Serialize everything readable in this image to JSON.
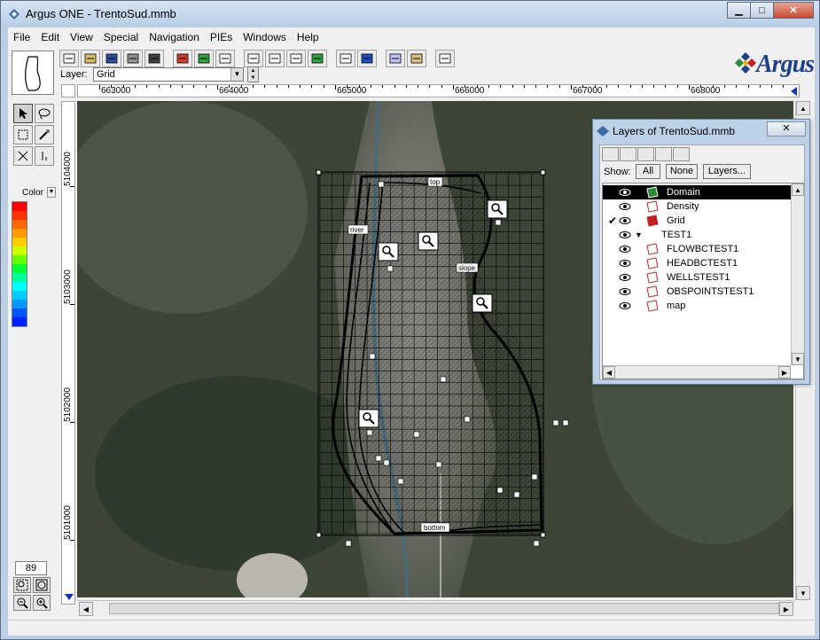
{
  "window": {
    "title": "Argus ONE - TrentoSud.mmb",
    "minimize": "▁",
    "maximize": "□",
    "close": "✕"
  },
  "menu": [
    "File",
    "Edit",
    "View",
    "Special",
    "Navigation",
    "PIEs",
    "Windows",
    "Help"
  ],
  "toolbar": {
    "layer_label": "Layer:",
    "layer_value": "Grid",
    "icons": [
      "new-icon",
      "open-icon",
      "save-icon",
      "print-icon",
      "find-icon",
      "color-icon",
      "layers-icon",
      "grid-icon",
      "zoom-extents-icon",
      "matrix-icon",
      "delete-icon",
      "export-icon",
      "table-icon",
      "run-icon",
      "settings-icon",
      "import-icon",
      "expand-icon"
    ]
  },
  "brand": {
    "name": "Argus"
  },
  "ruler": {
    "x_labels": [
      "663000",
      "664000",
      "665000",
      "666000",
      "667000",
      "668000"
    ],
    "y_labels": [
      "5104000",
      "5103000",
      "5102000",
      "5101000"
    ]
  },
  "palette": {
    "color_label": "Color",
    "colors": [
      "#ff0000",
      "#ff3300",
      "#ff6600",
      "#ff9900",
      "#ffcc00",
      "#ccff00",
      "#66ff00",
      "#00ff33",
      "#00ff99",
      "#00ffff",
      "#00ccff",
      "#0099ff",
      "#0055ff",
      "#0022ff"
    ],
    "zoom_value": "89"
  },
  "map": {
    "labels": [
      "top",
      "river",
      "slope",
      "bottom"
    ]
  },
  "layers_window": {
    "title": "Layers of TrentoSud.mmb",
    "close_glyph": "✕",
    "show_label": "Show:",
    "all_button": "All",
    "none_button": "None",
    "layers_button": "Layers...",
    "items": [
      {
        "name": "Domain",
        "selected": true,
        "checked": false,
        "sub": false
      },
      {
        "name": "Density",
        "selected": false,
        "checked": false,
        "sub": false
      },
      {
        "name": "Grid",
        "selected": false,
        "checked": true,
        "sub": false
      },
      {
        "name": "TEST1",
        "selected": false,
        "checked": false,
        "sub": true
      },
      {
        "name": "FLOWBCTEST1",
        "selected": false,
        "checked": false,
        "sub": false
      },
      {
        "name": "HEADBCTEST1",
        "selected": false,
        "checked": false,
        "sub": false
      },
      {
        "name": "WELLSTEST1",
        "selected": false,
        "checked": false,
        "sub": false
      },
      {
        "name": "OBSPOINTSTEST1",
        "selected": false,
        "checked": false,
        "sub": false
      },
      {
        "name": "map",
        "selected": false,
        "checked": false,
        "sub": false
      }
    ]
  }
}
